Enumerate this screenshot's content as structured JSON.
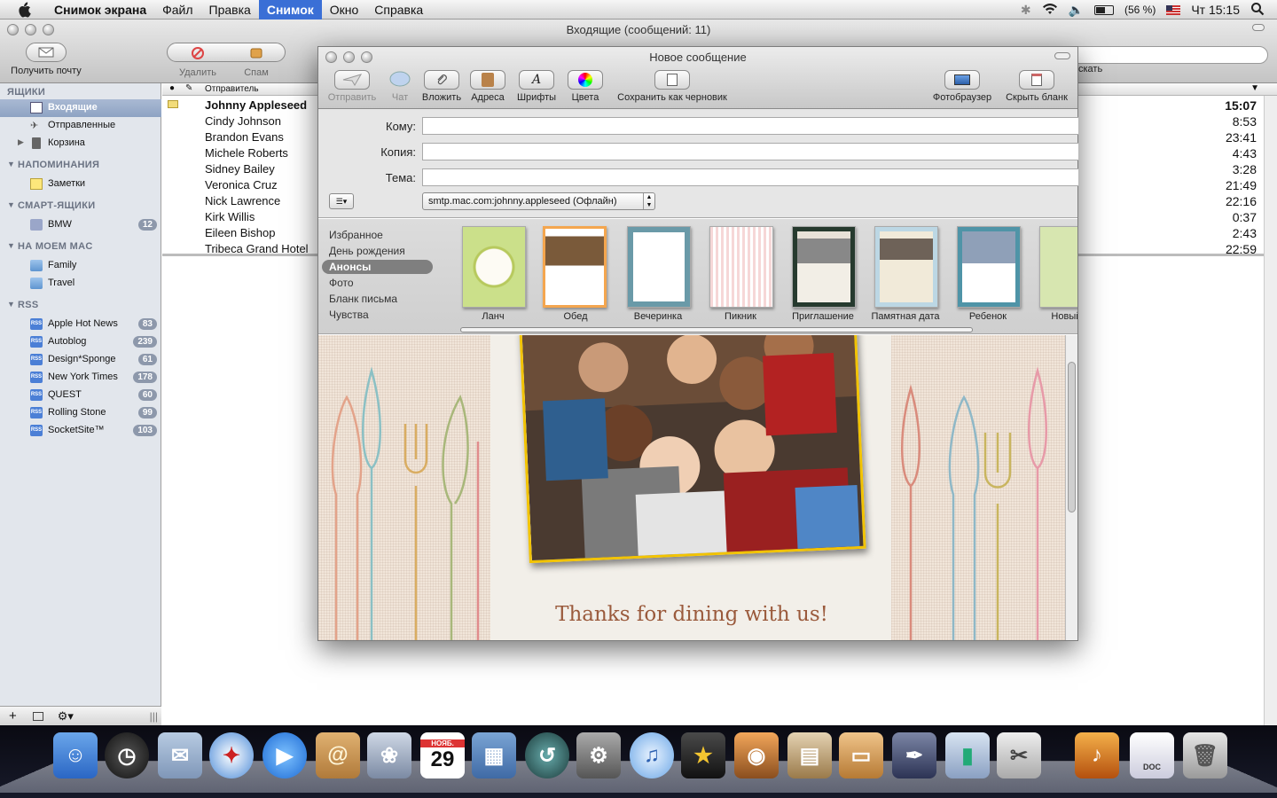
{
  "menubar": {
    "app": "Снимок экрана",
    "items": [
      "Файл",
      "Правка",
      "Снимок",
      "Окно",
      "Справка"
    ],
    "battery": "(56 %)",
    "clock": "Чт 15:15"
  },
  "mail": {
    "title": "Входящие (сообщений: 11)",
    "toolbar": {
      "get_mail": "Получить почту",
      "delete": "Удалить",
      "junk": "Спам",
      "search_hint": "скать"
    },
    "sidebar": {
      "mailboxes_header": "ЯЩИКИ",
      "inbox": "Входящие",
      "sent": "Отправленные",
      "trash": "Корзина",
      "reminders_header": "НАПОМИНАНИЯ",
      "notes": "Заметки",
      "smart_header": "СМАРТ-ЯЩИКИ",
      "bmw": "BMW",
      "bmw_count": "12",
      "onmac_header": "НА МОЕМ MAC",
      "family": "Family",
      "travel": "Travel",
      "rss_header": "RSS",
      "rss_label": "RSS",
      "feeds": [
        {
          "name": "Apple Hot News",
          "count": "83"
        },
        {
          "name": "Autoblog",
          "count": "239"
        },
        {
          "name": "Design*Sponge",
          "count": "61"
        },
        {
          "name": "New York Times",
          "count": "178"
        },
        {
          "name": "QUEST",
          "count": "60"
        },
        {
          "name": "Rolling Stone",
          "count": "99"
        },
        {
          "name": "SocketSite™",
          "count": "103"
        }
      ]
    },
    "list": {
      "col_from": "Отправитель",
      "rows": [
        {
          "from": "Johnny Appleseed",
          "time": "15:07"
        },
        {
          "from": "Cindy Johnson",
          "time": "8:53"
        },
        {
          "from": "Brandon Evans",
          "time": "23:41"
        },
        {
          "from": "Michele Roberts",
          "time": "4:43"
        },
        {
          "from": "Sidney Bailey",
          "time": "3:28"
        },
        {
          "from": "Veronica Cruz",
          "time": "21:49"
        },
        {
          "from": "Nick Lawrence",
          "time": "22:16"
        },
        {
          "from": "Kirk Willis",
          "time": "0:37"
        },
        {
          "from": "Eileen Bishop",
          "time": "2:43"
        },
        {
          "from": "Tribeca Grand Hotel",
          "time": "22:59"
        }
      ]
    }
  },
  "compose": {
    "title": "Новое сообщение",
    "toolbar": {
      "send": "Отправить",
      "chat": "Чат",
      "attach": "Вложить",
      "address": "Адреса",
      "fonts": "Шрифты",
      "colors": "Цвета",
      "save_draft": "Сохранить как черновик",
      "photo_browser": "Фотобраузер",
      "hide_stationery": "Скрыть бланк"
    },
    "fields": {
      "to": "Кому:",
      "cc": "Копия:",
      "subject": "Тема:",
      "account": "smtp.mac.com:johnny.appleseed (Офлайн)"
    },
    "stationery": {
      "categories": [
        "Избранное",
        "День рождения",
        "Анонсы",
        "Фото",
        "Бланк письма",
        "Чувства"
      ],
      "thumbs": [
        "Ланч",
        "Обед",
        "Вечеринка",
        "Пикник",
        "Приглашение",
        "Памятная дата",
        "Ребенок",
        "Новый а"
      ]
    },
    "body_caption": "Thanks for dining with us!"
  },
  "dock": {
    "calendar_month": "НОЯБ.",
    "calendar_day": "29",
    "doc_label": "DOC"
  },
  "colors": {
    "selection": "#3a6fd6",
    "sidebar_bg": "#e2e6ec",
    "photo_frame": "#f2c300",
    "caption": "#9a5a3c"
  }
}
